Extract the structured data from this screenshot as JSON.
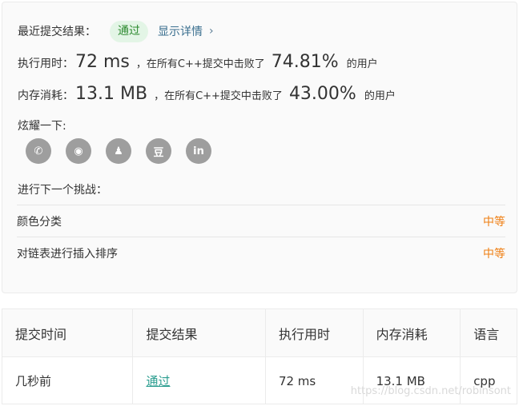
{
  "status": {
    "label": "最近提交结果：",
    "value": "通过",
    "detail_link": "显示详情",
    "chevron": "›"
  },
  "runtime": {
    "label": "执行用时：",
    "value": "72 ms",
    "middle": "，在所有C++提交中击败了",
    "percent": "74.81%",
    "tail": "的用户"
  },
  "memory": {
    "label": "内存消耗：",
    "value": "13.1 MB",
    "middle": "，在所有C++提交中击败了",
    "percent": "43.00%",
    "tail": "的用户"
  },
  "share": {
    "label": "炫耀一下:",
    "icons": [
      {
        "name": "wechat-icon",
        "glyph": "✆"
      },
      {
        "name": "weibo-icon",
        "glyph": "◉"
      },
      {
        "name": "qq-icon",
        "glyph": "♟"
      },
      {
        "name": "douban-icon",
        "glyph": "豆"
      },
      {
        "name": "linkedin-icon",
        "glyph": "in"
      }
    ]
  },
  "next": {
    "label": "进行下一个挑战：",
    "items": [
      {
        "title": "颜色分类",
        "difficulty": "中等"
      },
      {
        "title": "对链表进行插入排序",
        "difficulty": "中等"
      }
    ]
  },
  "table": {
    "headers": [
      "提交时间",
      "提交结果",
      "执行用时",
      "内存消耗",
      "语言"
    ],
    "row": [
      "几秒前",
      "通过",
      "72 ms",
      "13.1 MB",
      "cpp"
    ]
  },
  "watermark": "https://blog.csdn.net/robinsont",
  "colors": {
    "pass_green": "#2c8a2f",
    "difficulty_orange": "#ef7e12",
    "link_teal": "#2a9d8f"
  }
}
